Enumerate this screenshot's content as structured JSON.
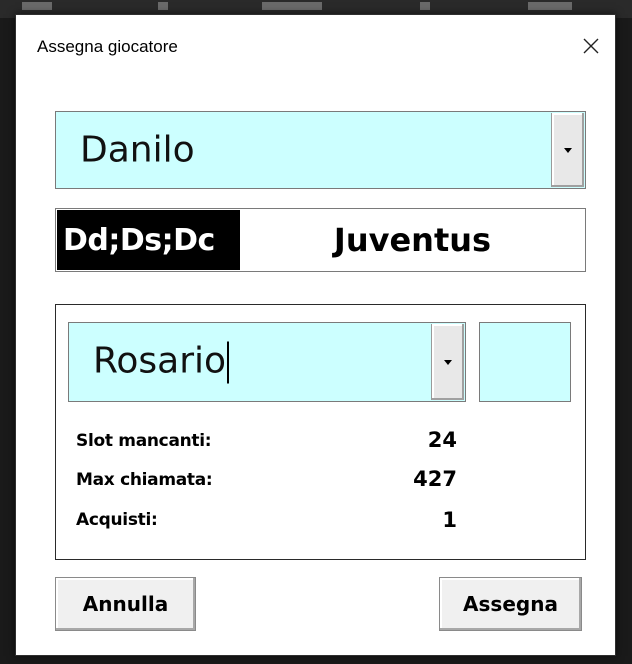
{
  "dialog": {
    "title": "Assegna giocatore",
    "close_icon": "close-icon"
  },
  "player": {
    "selected": "Danilo",
    "roles": "Dd;Ds;Dc",
    "team": "Juventus"
  },
  "assignment": {
    "selected_team": "Rosario",
    "price_value": "",
    "stats": [
      {
        "label": "Slot mancanti:",
        "value": "24"
      },
      {
        "label": "Max chiamata:",
        "value": "427"
      },
      {
        "label": "Acquisti:",
        "value": "1"
      }
    ]
  },
  "buttons": {
    "cancel": "Annulla",
    "assign": "Assegna"
  },
  "colors": {
    "field_bg": "#ccffff",
    "roles_bg": "#000000"
  }
}
